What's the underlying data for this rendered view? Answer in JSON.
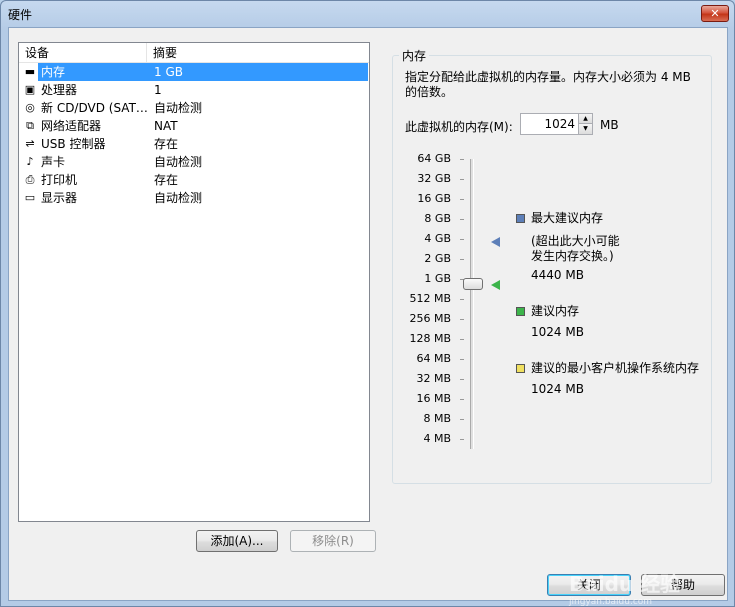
{
  "window": {
    "title": "硬件",
    "close_glyph": "✕"
  },
  "device_list": {
    "columns": [
      "设备",
      "摘要"
    ],
    "rows": [
      {
        "icon": "memory-icon",
        "glyph": "▬",
        "name": "内存",
        "summary": "1 GB",
        "selected": true
      },
      {
        "icon": "processor-icon",
        "glyph": "▣",
        "name": "处理器",
        "summary": "1"
      },
      {
        "icon": "cd-dvd-icon",
        "glyph": "◎",
        "name": "新 CD/DVD (SAT…",
        "summary": "自动检测"
      },
      {
        "icon": "network-adapter-icon",
        "glyph": "⧉",
        "name": "网络适配器",
        "summary": "NAT"
      },
      {
        "icon": "usb-controller-icon",
        "glyph": "⇌",
        "name": "USB 控制器",
        "summary": "存在"
      },
      {
        "icon": "sound-card-icon",
        "glyph": "♪",
        "name": "声卡",
        "summary": "自动检测"
      },
      {
        "icon": "printer-icon",
        "glyph": "⎙",
        "name": "打印机",
        "summary": "存在"
      },
      {
        "icon": "display-icon",
        "glyph": "▭",
        "name": "显示器",
        "summary": "自动检测"
      }
    ]
  },
  "buttons": {
    "add": "添加(A)...",
    "remove": "移除(R)",
    "close": "关闭",
    "help": "帮助"
  },
  "memory": {
    "group_title": "内存",
    "description": "指定分配给此虚拟机的内存量。内存大小必须为 4 MB 的倍数。",
    "field_label": "此虚拟机的内存(M):",
    "value": "1024",
    "unit": "MB",
    "scale_labels": [
      "64 GB",
      "32 GB",
      "16 GB",
      "8 GB",
      "4 GB",
      "2 GB",
      "1 GB",
      "512 MB",
      "256 MB",
      "128 MB",
      "64 MB",
      "32 MB",
      "16 MB",
      "8 MB",
      "4 MB"
    ],
    "legend": {
      "max_recommended": {
        "label": "最大建议内存",
        "note1": "(超出此大小可能",
        "note2": "发生内存交换。)",
        "value": "4440 MB",
        "color": "#5d7fb8"
      },
      "recommended": {
        "label": "建议内存",
        "value": "1024 MB",
        "color": "#3cb44b"
      },
      "min_guest": {
        "label": "建议的最小客户机操作系统内存",
        "value": "1024 MB",
        "color": "#f0e060"
      }
    }
  },
  "watermark": {
    "text": "Baidu 经验",
    "sub": "jingyan.baidu.com"
  }
}
